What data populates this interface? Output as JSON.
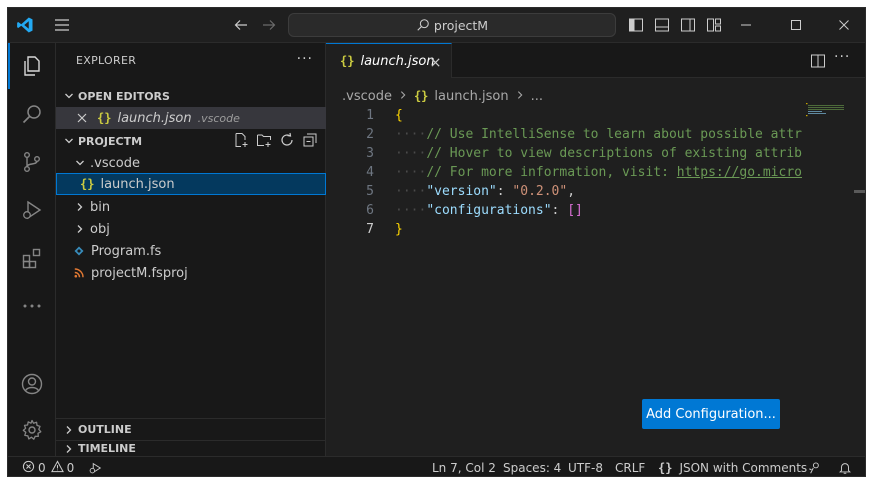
{
  "titlebar": {
    "search_text": "projectM"
  },
  "sidebar": {
    "title": "EXPLORER",
    "more": "···",
    "open_editors": {
      "label": "OPEN EDITORS",
      "items": [
        {
          "name": "launch.json",
          "description": ".vscode",
          "icon": "{}"
        }
      ]
    },
    "folder": {
      "label": "PROJECTM",
      "items": [
        {
          "name": ".vscode",
          "type": "folder-open"
        },
        {
          "name": "launch.json",
          "type": "json-file",
          "icon": "{}"
        },
        {
          "name": "bin",
          "type": "folder"
        },
        {
          "name": "obj",
          "type": "folder"
        },
        {
          "name": "Program.fs",
          "type": "fsharp-file"
        },
        {
          "name": "projectM.fsproj",
          "type": "rss-file"
        }
      ]
    },
    "outline": "OUTLINE",
    "timeline": "TIMELINE"
  },
  "editor": {
    "tab": {
      "label": "launch.json",
      "icon": "{}"
    },
    "breadcrumb": {
      "folder": ".vscode",
      "file": "launch.json",
      "icon": "{}",
      "more": "..."
    },
    "line_numbers": [
      "1",
      "2",
      "3",
      "4",
      "5",
      "6",
      "7"
    ],
    "code": {
      "line1": "{",
      "line2_comment": "// Use IntelliSense to learn about possible attr",
      "line3_comment": "// Hover to view descriptions of existing attrib",
      "line4_comment": "// For more information, visit: ",
      "line4_link": "https://go.micro",
      "line5_key": "\"version\"",
      "line5_colon": ": ",
      "line5_value": "\"0.2.0\"",
      "line5_comma": ",",
      "line6_key": "\"configurations\"",
      "line6_colon": ": ",
      "line6_value": "[]",
      "line7": "}"
    },
    "add_config_button": "Add Configuration..."
  },
  "statusbar": {
    "errors": "0",
    "warnings": "0",
    "position": "Ln 7, Col 2",
    "spaces": "Spaces: 4",
    "encoding": "UTF-8",
    "eol": "CRLF",
    "language": "JSON with Comments",
    "language_icon": "{}"
  },
  "colors": {
    "accent": "#0078d4",
    "background": "#1f1f1f",
    "sidebar": "#181818"
  }
}
